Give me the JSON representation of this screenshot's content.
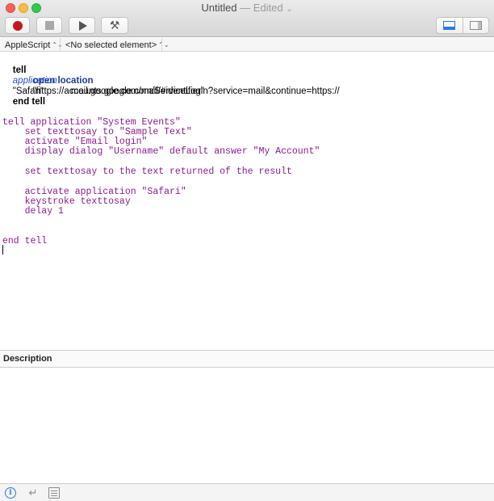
{
  "window": {
    "title": "Untitled",
    "separator": " — ",
    "edited": "Edited",
    "edited_chevron": "⌄"
  },
  "toolbar": {
    "record": "record-icon",
    "stop": "stop-icon",
    "run": "run-icon",
    "compile": "hammer-icon",
    "compile_glyph": "⚒"
  },
  "nav": {
    "language": "AppleScript",
    "element": "<No selected element>",
    "updown": "⌃⌄"
  },
  "code": {
    "l1_kw": "tell",
    "l1_cls": "application",
    "l1_str": "\"Safari\"",
    "l2_kw": "open location",
    "l2_str": "\"https://accounts.google.com/ServiceLogin?service=mail&continue=https://",
    "l3_str": "mail.google.com/mail/#identifier\"",
    "l4_kw": "end tell",
    "m1": "tell application \"System Events\"",
    "m2": "    set texttosay to \"Sample Text\"",
    "m3": "    activate \"Email login\"",
    "m4": "    display dialog \"Username\" default answer \"My Account\"",
    "m5": "    set texttosay to the text returned of the result",
    "m6": "    activate application \"Safari\"",
    "m7": "    keystroke texttosay",
    "m8": "    delay 1",
    "m9": "end tell"
  },
  "description": {
    "header": "Description"
  },
  "bottom": {
    "info_glyph": "i",
    "return_glyph": "↵"
  }
}
